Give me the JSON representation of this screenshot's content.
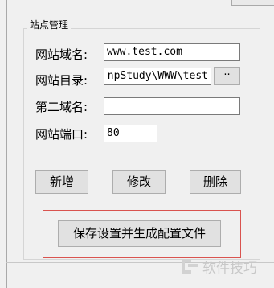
{
  "group": {
    "title": "站点管理"
  },
  "fields": {
    "domain": {
      "label": "网站域名:",
      "value": "www.test.com"
    },
    "directory": {
      "label": "网站目录:",
      "value": "npStudy\\WWW\\test",
      "browse_label": "··"
    },
    "second_domain": {
      "label": "第二域名:",
      "value": ""
    },
    "port": {
      "label": "网站端口:",
      "value": "80"
    }
  },
  "buttons": {
    "add": "新增",
    "modify": "修改",
    "delete": "删除",
    "save": "保存设置并生成配置文件"
  },
  "watermark": {
    "text": "软件技巧"
  },
  "colors": {
    "highlight_border": "#d9534f"
  }
}
